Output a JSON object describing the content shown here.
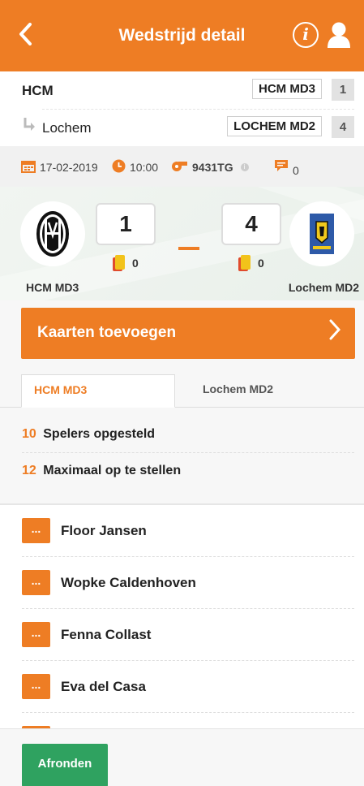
{
  "header": {
    "title": "Wedstrijd detail",
    "back_icon": "chevron-left-icon",
    "info_label": "i",
    "info_icon": "info-icon",
    "user_icon": "user-icon",
    "color": "#ee7d24"
  },
  "teams": {
    "home": {
      "name": "HCM",
      "code": "HCM MD3",
      "number": "1"
    },
    "away": {
      "name": "Lochem",
      "code": "LOCHEM MD2",
      "number": "4"
    }
  },
  "meta": {
    "date": "17-02-2019",
    "time": "10:00",
    "referee_code": "9431TG",
    "comments_count": "0"
  },
  "score": {
    "home": "1",
    "away": "4",
    "home_cards": "0",
    "away_cards": "0",
    "home_label": "HCM MD3",
    "away_label": "Lochem MD2"
  },
  "actions": {
    "add_cards_label": "Kaarten toevoegen",
    "finish_label": "Afronden"
  },
  "tabs": [
    {
      "label": "HCM MD3",
      "active": true
    },
    {
      "label": "Lochem MD2",
      "active": false
    }
  ],
  "summary": {
    "lined_up_count": "10",
    "lined_up_label": "Spelers opgesteld",
    "max_count": "12",
    "max_label": "Maximaal op te stellen"
  },
  "player_more_label": "...",
  "players": [
    {
      "name": "Floor Jansen"
    },
    {
      "name": "Wopke Caldenhoven"
    },
    {
      "name": "Fenna Collast"
    },
    {
      "name": "Eva del Casa"
    }
  ],
  "colors": {
    "accent": "#ee7d24",
    "success": "#2fa260"
  }
}
